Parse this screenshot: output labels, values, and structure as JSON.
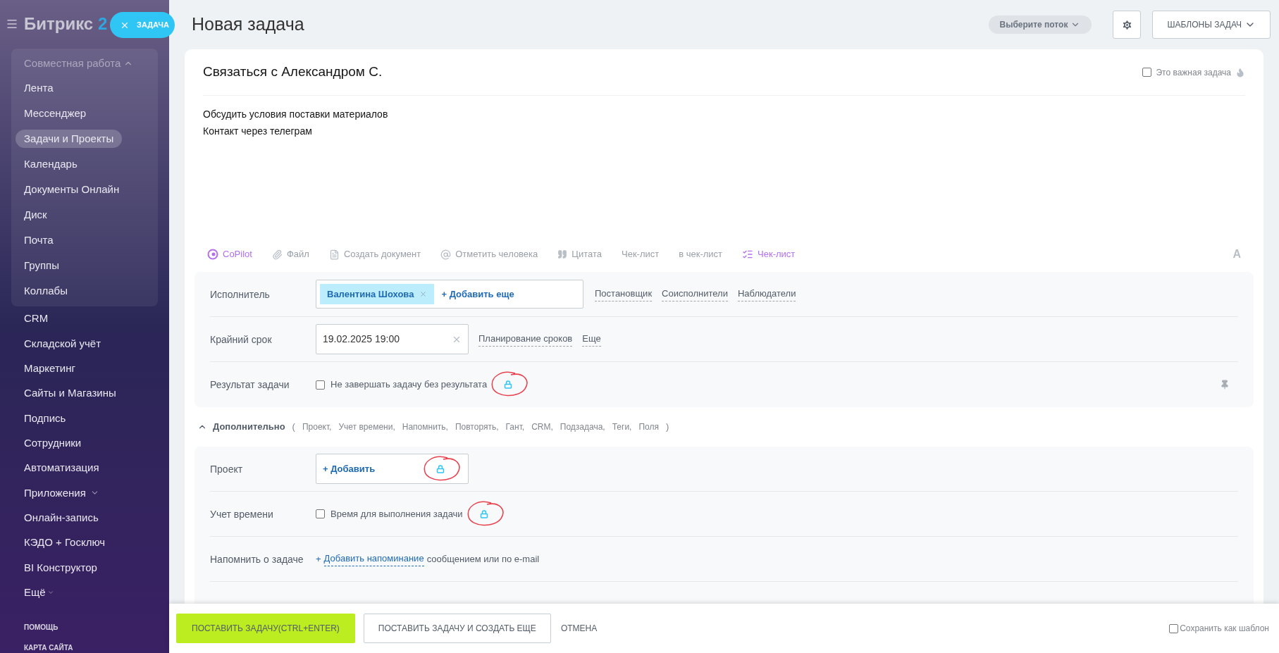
{
  "sidebar": {
    "logo": {
      "name": "Битрикс",
      "number": "2"
    },
    "new_task_button": "ЗАДАЧА",
    "group": {
      "label": "Совместная работа",
      "expanded": true,
      "items": [
        {
          "label": "Лента",
          "selected": false
        },
        {
          "label": "Мессенджер",
          "selected": false
        },
        {
          "label": "Задачи и Проекты",
          "selected": true
        },
        {
          "label": "Календарь",
          "selected": false
        },
        {
          "label": "Документы Онлайн",
          "selected": false
        },
        {
          "label": "Диск",
          "selected": false
        },
        {
          "label": "Почта",
          "selected": false
        },
        {
          "label": "Группы",
          "selected": false
        },
        {
          "label": "Коллабы",
          "selected": false
        }
      ]
    },
    "items": [
      {
        "label": "CRM",
        "has_submenu": false
      },
      {
        "label": "Складской учёт",
        "has_submenu": false
      },
      {
        "label": "Маркетинг",
        "has_submenu": false
      },
      {
        "label": "Сайты и Магазины",
        "has_submenu": false
      },
      {
        "label": "Подпись",
        "has_submenu": false
      },
      {
        "label": "Сотрудники",
        "has_submenu": false
      },
      {
        "label": "Автоматизация",
        "has_submenu": false
      },
      {
        "label": "Приложения",
        "has_submenu": true
      },
      {
        "label": "Онлайн-запись",
        "has_submenu": false
      },
      {
        "label": "КЭДО + Госключ",
        "has_submenu": false
      },
      {
        "label": "BI Конструктор",
        "has_submenu": false
      }
    ],
    "more": "Ещё",
    "footer_links": [
      "ПОМОЩЬ",
      "КАРТА САЙТА"
    ]
  },
  "header": {
    "title": "Новая задача",
    "flow_select": "Выберите поток",
    "templates_button": "ШАБЛОНЫ ЗАДАЧ"
  },
  "task": {
    "title": "Связаться с Александром С.",
    "important": {
      "label": "Это важная задача",
      "checked": false
    },
    "description": [
      "Обсудить условия поставки материалов",
      "Контакт через телеграм"
    ]
  },
  "toolbar": [
    {
      "kind": "copilot",
      "label": "CoPilot"
    },
    {
      "kind": "file",
      "label": "Файл"
    },
    {
      "kind": "document",
      "label": "Создать документ"
    },
    {
      "kind": "mention",
      "label": "Отметить человека"
    },
    {
      "kind": "quote",
      "label": "Цитата"
    },
    {
      "kind": "text",
      "label": "Чек-лист"
    },
    {
      "kind": "text",
      "label": "в чек-лист"
    },
    {
      "kind": "checklist",
      "label": "Чек-лист"
    }
  ],
  "format_button": "A",
  "main_fields": {
    "assignee": {
      "label": "Исполнитель",
      "chip": "Валентина Шохова",
      "add": "+ Добавить еще",
      "links": [
        "Постановщик",
        "Соисполнители",
        "Наблюдатели"
      ]
    },
    "deadline": {
      "label": "Крайний срок",
      "value": "19.02.2025 19:00",
      "links": [
        "Планирование сроков",
        "Еще"
      ]
    },
    "result": {
      "label": "Результат задачи",
      "option": "Не завершать задачу без результата",
      "checked": false,
      "locked": true
    }
  },
  "additional": {
    "label": "Дополнительно",
    "expanded": true,
    "open_bracket": "(",
    "close_bracket": ")",
    "sections": [
      "Проект,",
      "Учет времени,",
      "Напомнить,",
      "Повторять,",
      "Гант,",
      "CRM,",
      "Подзадача,",
      "Теги,",
      "Поля"
    ],
    "project": {
      "label": "Проект",
      "add": "+ Добавить",
      "locked": true
    },
    "time": {
      "label": "Учет времени",
      "option": "Время для выполнения задачи",
      "checked": false,
      "locked": true
    },
    "reminder": {
      "label": "Напомнить о задаче",
      "plus": "+",
      "link": "Добавить напоминание",
      "suffix": "сообщением или по e-mail"
    }
  },
  "footer": {
    "submit": "ПОСТАВИТЬ ЗАДАЧУ(CTRL+ENTER)",
    "submit_more": "ПОСТАВИТЬ ЗАДАЧУ И СОЗДАТЬ ЕЩЕ",
    "cancel": "ОТМЕНА",
    "save_template": {
      "label": "Сохранить как шаблон",
      "checked": false
    }
  }
}
